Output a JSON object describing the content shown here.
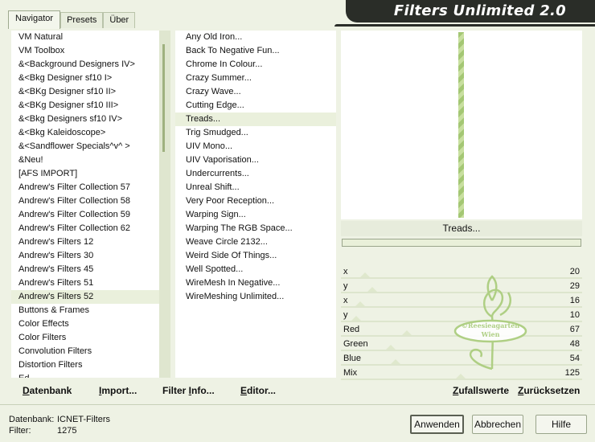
{
  "tabs": [
    "Navigator",
    "Presets",
    "Über"
  ],
  "app_title": "Filters Unlimited 2.0",
  "categories": [
    "VM Natural",
    "VM Toolbox",
    "&<Background Designers IV>",
    "&<Bkg Designer sf10 I>",
    "&<BKg Designer sf10 II>",
    "&<BKg Designer sf10 III>",
    "&<Bkg Designers sf10 IV>",
    "&<Bkg Kaleidoscope>",
    "&<Sandflower Specials^v^ >",
    "&Neu!",
    "[AFS IMPORT]",
    "Andrew's Filter Collection 57",
    "Andrew's Filter Collection 58",
    "Andrew's Filter Collection 59",
    "Andrew's Filter Collection 62",
    "Andrew's Filters 12",
    "Andrew's Filters 30",
    "Andrew's Filters 45",
    "Andrew's Filters 51",
    "Andrew's Filters 52",
    "Buttons & Frames",
    "Color Effects",
    "Color Filters",
    "Convolution Filters",
    "Distortion Filters",
    "Ed..."
  ],
  "selected_category": "Andrew's Filters 52",
  "filters": [
    "Any Old Iron...",
    "Back To Negative Fun...",
    "Chrome In Colour...",
    "Crazy Summer...",
    "Crazy Wave...",
    "Cutting Edge...",
    "Treads...",
    "Trig Smudged...",
    "UIV Mono...",
    "UIV Vaporisation...",
    "Undercurrents...",
    "Unreal Shift...",
    "Very Poor Reception...",
    "Warping Sign...",
    "Warping The RGB Space...",
    "Weave Circle 2132...",
    "Weird Side Of Things...",
    "Well Spotted...",
    "WireMesh In Negative...",
    "WireMeshing Unlimited..."
  ],
  "selected_filter": "Treads...",
  "preview_filter_name": "Treads...",
  "params": [
    {
      "label": "x",
      "value": "20",
      "knob": 0.08
    },
    {
      "label": "y",
      "value": "29",
      "knob": 0.11
    },
    {
      "label": "x",
      "value": "16",
      "knob": 0.06
    },
    {
      "label": "y",
      "value": "10",
      "knob": 0.04
    },
    {
      "label": "Red",
      "value": "67",
      "knob": 0.26
    },
    {
      "label": "Green",
      "value": "48",
      "knob": 0.19
    },
    {
      "label": "Blue",
      "value": "54",
      "knob": 0.21
    },
    {
      "label": "Mix",
      "value": "125",
      "knob": 0.49
    }
  ],
  "logo_text": [
    "©Reesieagarten",
    "Wien"
  ],
  "bottom_buttons": {
    "database": {
      "u": "D",
      "rest": "atenbank"
    },
    "import": {
      "u": "I",
      "rest": "mport..."
    },
    "filter_info": {
      "pre": "Filter ",
      "u": "I",
      "rest": "nfo..."
    },
    "editor": {
      "u": "E",
      "rest": "ditor..."
    },
    "random": {
      "u": "Z",
      "rest": "ufallswerte"
    },
    "reset": {
      "u": "Z",
      "rest": "urücksetzen"
    }
  },
  "status": {
    "db_label": "Datenbank:",
    "db_value": "ICNET-Filters",
    "filter_label": "Filter:",
    "filter_value": "1275"
  },
  "buttons": {
    "apply": "Anwenden",
    "cancel": "Abbrechen",
    "help": "Hilfe"
  },
  "colors": {
    "accent_green": "#a4c774",
    "banner_bg": "#2a2d28",
    "selection_bg": "#eaf0dc"
  }
}
